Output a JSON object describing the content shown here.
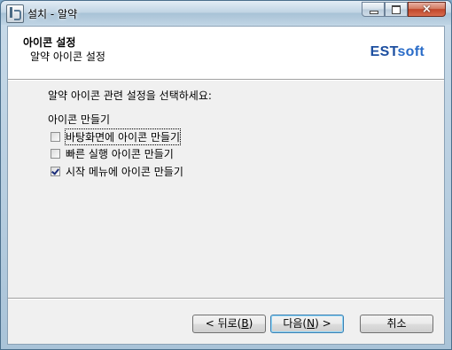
{
  "window": {
    "title": "설치 - 알약",
    "icon": "setup-app-icon",
    "controls": {
      "minimize": "minimize-icon",
      "maximize": "maximize-icon",
      "close": "×"
    }
  },
  "header": {
    "title": "아이콘 설정",
    "subtitle": "알약 아이콘 설정",
    "logo": {
      "part1": "EST",
      "part2": "soft"
    }
  },
  "content": {
    "instruction": "알약 아이콘 관련 설정을 선택하세요:",
    "group_label": "아이콘 만들기",
    "options": [
      {
        "label": "바탕화면에 아이콘 만들기",
        "checked": false
      },
      {
        "label": "빠른 실행 아이콘 만들기",
        "checked": false
      },
      {
        "label": "시작 메뉴에 아이콘 만들기",
        "checked": true
      }
    ]
  },
  "buttons": {
    "back": {
      "prefix": "< 뒤로(",
      "key": "B",
      "suffix": ")"
    },
    "next": {
      "prefix": "다음(",
      "key": "N",
      "suffix": ") >"
    },
    "cancel": "취소"
  },
  "colors": {
    "logo": "#1d4fa0",
    "titlebar": "#bfd3e3",
    "close": "#c0462a"
  }
}
